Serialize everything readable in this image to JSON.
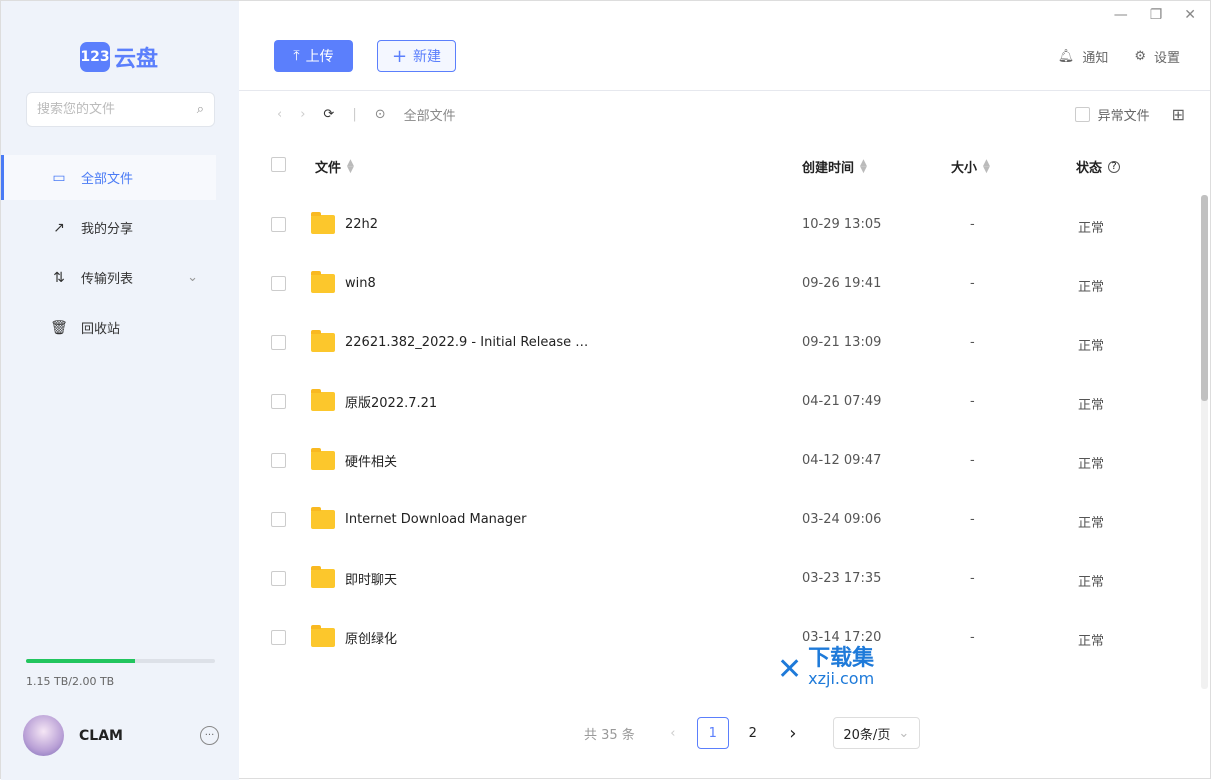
{
  "app": {
    "logo_badge": "123",
    "logo_text": "云盘"
  },
  "sidebar": {
    "search_placeholder": "搜索您的文件",
    "items": [
      {
        "label": "全部文件",
        "icon": "folder-icon",
        "active": true
      },
      {
        "label": "我的分享",
        "icon": "share-icon"
      },
      {
        "label": "传输列表",
        "icon": "transfer-icon",
        "expandable": true
      },
      {
        "label": "回收站",
        "icon": "trash-icon"
      }
    ],
    "storage": {
      "text": "1.15 TB/2.00 TB",
      "used_fraction": 0.575
    },
    "user": {
      "name": "CLAM"
    }
  },
  "header": {
    "upload_label": "上传",
    "new_label": "新建",
    "notify_label": "通知",
    "settings_label": "设置"
  },
  "toolbar": {
    "breadcrumb": "全部文件",
    "abnormal_label": "异常文件"
  },
  "table": {
    "columns": [
      "文件",
      "创建时间",
      "大小",
      "状态"
    ],
    "rows": [
      {
        "name": "22h2",
        "created": "10-29 13:05",
        "size": "-",
        "status": "正常"
      },
      {
        "name": "win8",
        "created": "09-26 19:41",
        "size": "-",
        "status": "正常"
      },
      {
        "name": "22621.382_2022.9 - Initial Release …",
        "created": "09-21 13:09",
        "size": "-",
        "status": "正常"
      },
      {
        "name": "原版2022.7.21",
        "created": "04-21 07:49",
        "size": "-",
        "status": "正常"
      },
      {
        "name": "硬件相关",
        "created": "04-12 09:47",
        "size": "-",
        "status": "正常"
      },
      {
        "name": "Internet Download Manager",
        "created": "03-24 09:06",
        "size": "-",
        "status": "正常"
      },
      {
        "name": "即时聊天",
        "created": "03-23 17:35",
        "size": "-",
        "status": "正常"
      },
      {
        "name": "原创绿化",
        "created": "03-14 17:20",
        "size": "-",
        "status": "正常"
      }
    ]
  },
  "pagination": {
    "total": "共 35 条",
    "pages": [
      "1",
      "2"
    ],
    "current": "1",
    "page_size": "20条/页"
  },
  "watermark": {
    "text": "下载集",
    "domain": "xzji.com"
  },
  "colors": {
    "accent": "#5b7ffc",
    "sidebar_bg": "#eff3fa",
    "folder": "#fcc72c",
    "storage_bar": "#22c55e"
  }
}
